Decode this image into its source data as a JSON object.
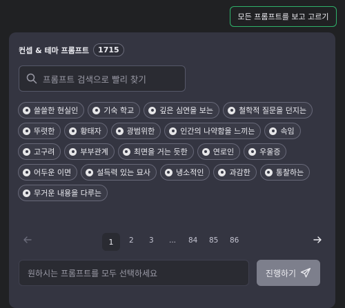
{
  "top_button": {
    "label": "모든 프롬프트를 보고 고르기"
  },
  "panel": {
    "title": "컨셉 & 테마 프롬프트",
    "count": "1715",
    "search": {
      "placeholder": "프롬프트 검색으로 빨리 찾기",
      "icon": "search-icon"
    },
    "chip_rows": [
      [
        "쓸쓸한 현실인",
        "기숙 학교",
        "깊은 심연을 보는",
        "철학적 질문을 던지는"
      ],
      [
        "뚜렷한",
        "황태자",
        "광범위한",
        "인간의 나약함을 느끼는",
        "속임"
      ],
      [
        "고구려",
        "부부관계",
        "최면을 거는 듯한",
        "연로인",
        "우울증"
      ],
      [
        "어두운 이면",
        "설득력 있는 묘사",
        "냉소적인",
        "과감한",
        "통찰하는"
      ],
      [
        "무거운 내용을 다루는"
      ]
    ],
    "pagination": {
      "current": "1",
      "pages": [
        "2",
        "3",
        "...",
        "84",
        "85",
        "86"
      ],
      "prev_icon": "arrow-left-icon",
      "next_icon": "arrow-right-icon"
    },
    "footer": {
      "input_placeholder": "원하시는 프롬프트를 모두 선택하세요",
      "submit_label": "진행하기",
      "submit_icon": "send-icon"
    }
  },
  "colors": {
    "accent": "#2fb36b",
    "panel": "#343541",
    "background": "#202123"
  }
}
